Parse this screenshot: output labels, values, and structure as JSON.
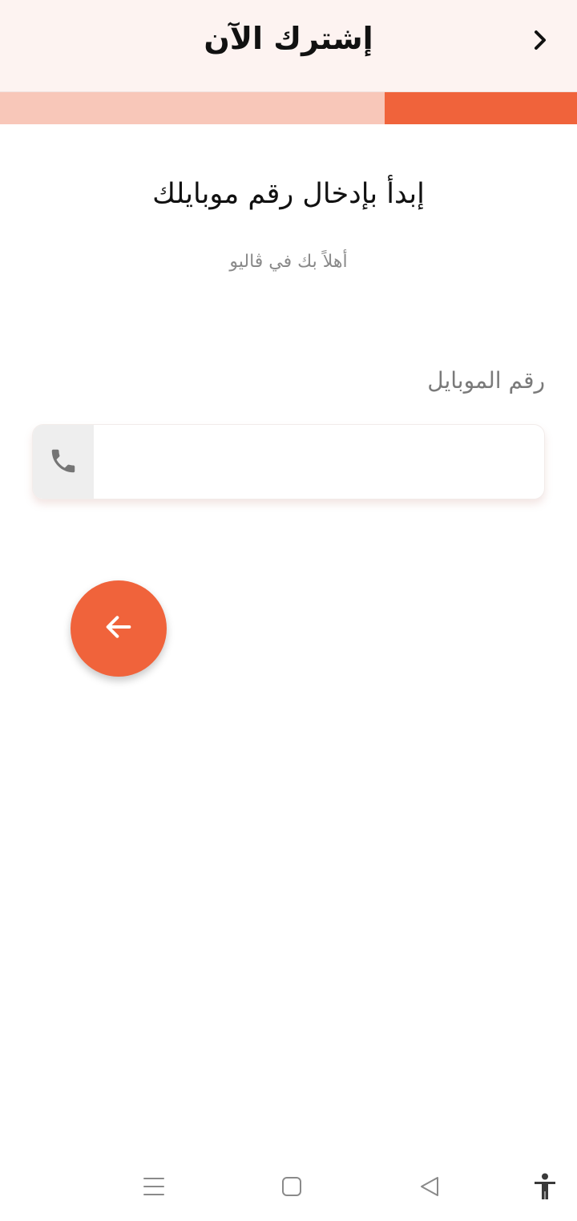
{
  "header": {
    "title": "إشترك الآن",
    "back_icon": "chevron-right-icon"
  },
  "progress": {
    "fraction": 0.333,
    "fill_color": "#f0633b",
    "track_color": "#f8c7b9"
  },
  "main": {
    "heading": "إبدأ بإدخال رقم موبايلك",
    "subheading": "أهلاً بك في ڤاليو"
  },
  "form": {
    "phone_label": "رقم الموبايل",
    "phone_value": "",
    "phone_placeholder": "",
    "phone_icon": "phone-icon"
  },
  "actions": {
    "next_icon": "arrow-left-icon",
    "accent_color": "#f0633b"
  },
  "navbar": {
    "icons": [
      "menu-icon",
      "home-icon",
      "back-triangle-icon",
      "accessibility-icon"
    ]
  }
}
